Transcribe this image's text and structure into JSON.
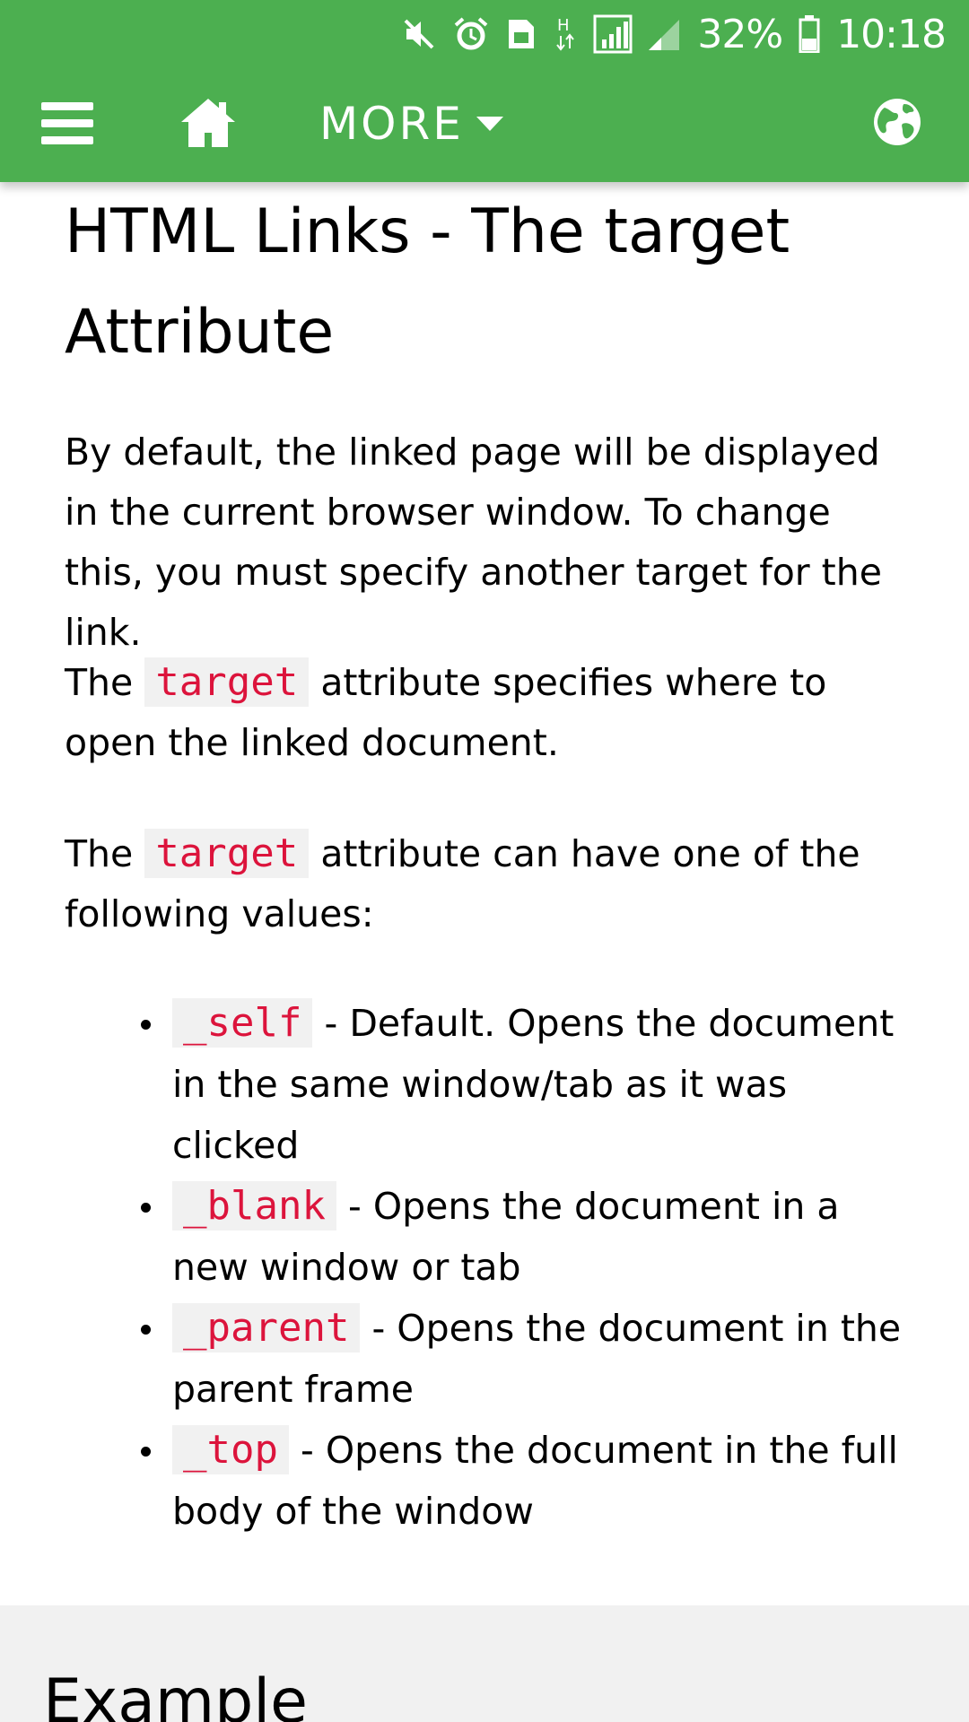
{
  "status_bar": {
    "battery_percent": "32%",
    "time": "10:18",
    "icons": [
      "mute-icon",
      "alarm-icon",
      "sim-icon",
      "data-h-icon",
      "signal-icon",
      "signal-weak-icon",
      "battery-icon"
    ]
  },
  "nav": {
    "menu_icon": "hamburger-icon",
    "home_icon": "home-icon",
    "more_label": "MORE",
    "more_icon": "caret-down-icon",
    "globe_icon": "globe-icon",
    "accent_color": "#4caf50"
  },
  "article": {
    "title": "HTML Links - The target Attribute",
    "para1": "By default, the linked page will be displayed in the current browser window. To change this, you must specify another target for the link.",
    "para2": {
      "prefix": "The",
      "code": "target",
      "suffix": "attribute specifies where to open the linked document."
    },
    "para3": {
      "prefix": "The",
      "code": "target",
      "suffix": "attribute can have one of the following values:"
    },
    "values": [
      {
        "code": "_self",
        "text": "- Default. Opens the document in the same window/tab as it was clicked"
      },
      {
        "code": "_blank",
        "text": "- Opens the document in a new window or tab"
      },
      {
        "code": "_parent",
        "text": "- Opens the document in the parent frame"
      },
      {
        "code": "_top",
        "text": "- Opens the document in the full body of the window"
      }
    ],
    "code_color": "#dc143c"
  },
  "example": {
    "heading": "Example"
  }
}
